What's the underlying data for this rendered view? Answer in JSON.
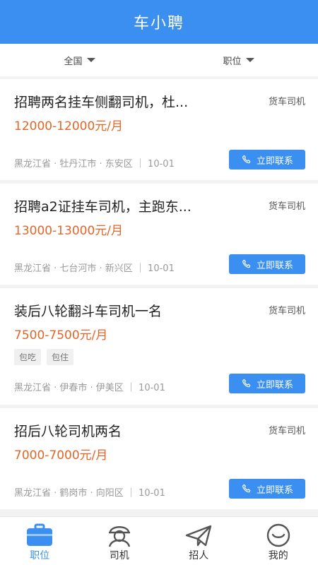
{
  "header": {
    "title": "车小聘"
  },
  "filters": {
    "region": "全国",
    "position": "职位"
  },
  "jobs": [
    {
      "title": "招聘两名挂车侧翻司机，杜...",
      "category": "货车司机",
      "salary": "12000-12000元/月",
      "tags": [],
      "location": "黑龙江省 · 牡丹江市 · 东安区 ｜ 10-01",
      "action": "立即联系"
    },
    {
      "title": "招聘a2证挂车司机，主跑东...",
      "category": "货车司机",
      "salary": "13000-13000元/月",
      "tags": [],
      "location": "黑龙江省 · 七台河市 · 新兴区 ｜ 10-01",
      "action": "立即联系"
    },
    {
      "title": "装后八轮翻斗车司机一名",
      "category": "货车司机",
      "salary": "7500-7500元/月",
      "tags": [
        "包吃",
        "包住"
      ],
      "location": "黑龙江省 · 伊春市 · 伊美区 ｜ 10-01",
      "action": "立即联系"
    },
    {
      "title": "招后八轮司机两名",
      "category": "货车司机",
      "salary": "7000-7000元/月",
      "tags": [],
      "location": "黑龙江省 · 鹤岗市 · 向阳区 ｜ 10-01",
      "action": "立即联系"
    }
  ],
  "tabs": [
    {
      "label": "职位",
      "icon": "briefcase-icon"
    },
    {
      "label": "司机",
      "icon": "driver-icon"
    },
    {
      "label": "招人",
      "icon": "paper-plane-icon"
    },
    {
      "label": "我的",
      "icon": "smile-icon"
    }
  ],
  "colors": {
    "primary": "#3b8ff0",
    "salary": "#e0662a"
  }
}
